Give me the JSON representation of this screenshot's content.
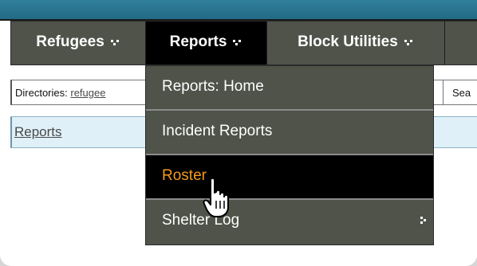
{
  "nav": {
    "items": [
      {
        "label": "Refugees"
      },
      {
        "label": "Reports"
      },
      {
        "label": "Block Utilities"
      }
    ]
  },
  "directories": {
    "label": "Directories:",
    "link": "refugee",
    "search_partial": "Sea"
  },
  "reports_bar": {
    "link": "Reports"
  },
  "dropdown": {
    "items": [
      {
        "label": "Reports: Home"
      },
      {
        "label": "Incident Reports"
      },
      {
        "label": "Roster"
      },
      {
        "label": "Shelter Log"
      }
    ]
  },
  "colors": {
    "nav_bg": "#4f5349",
    "active_bg": "#000000",
    "active_text": "#f39a1a",
    "top_band": "#2f7f9b",
    "reports_bar_bg": "#dff0f8"
  }
}
